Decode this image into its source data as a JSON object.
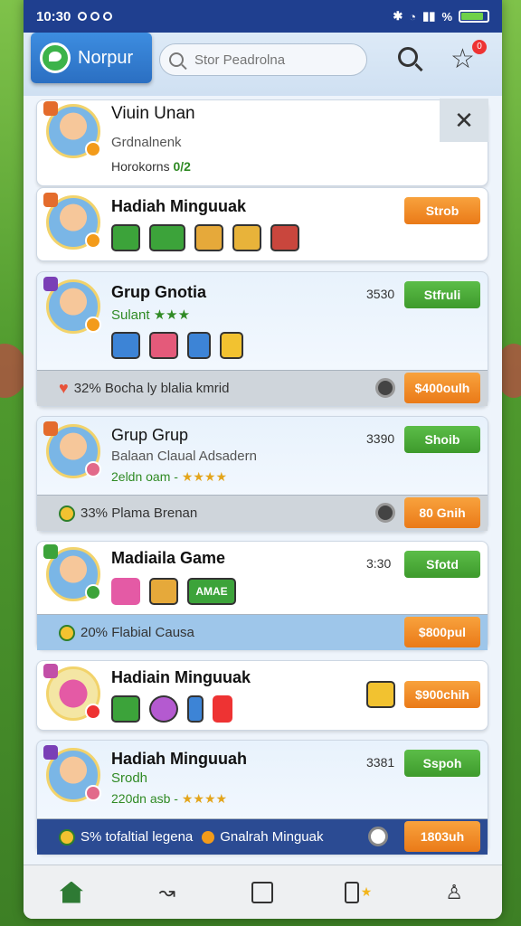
{
  "status": {
    "time": "10:30"
  },
  "app": {
    "brand": "Norpur",
    "search_placeholder": "Stor Peadrolna",
    "notif_count": "0"
  },
  "cards": [
    {
      "title": "Viuin Unan",
      "subtitle": "Grdnalnenk",
      "meta_label": "Horokorns",
      "meta_value": "0/2"
    },
    {
      "title": "Hadiah Minguuak",
      "button": "Strob"
    },
    {
      "title": "Grup Gnotia",
      "subtitle": "Sulant",
      "count": "3530",
      "button": "Stfruli",
      "footer_text": "32% Bocha ly blalia kmrid",
      "footer_button": "$400oulh"
    },
    {
      "title": "Grup Grup",
      "subtitle": "Balaan Claual Adsadern",
      "meta": "2eldn oam -",
      "count": "3390",
      "button": "Shoib",
      "footer_text": "33% Plama Brenan",
      "footer_button": "80 Gnih"
    },
    {
      "title": "Madiaila Game",
      "count": "3:30",
      "button": "Sfotd",
      "item_badge": "AMAE",
      "footer_text": "20% Flabial Causa",
      "footer_button": "$800pul"
    },
    {
      "title": "Hadiain Minguuak",
      "footer_button": "$900chih"
    },
    {
      "title": "Hadiah Minguuah",
      "subtitle": "Srodh",
      "meta": "220dn asb -",
      "count": "3381",
      "button": "Sspoh",
      "footer_text": "S% tofaltial legena",
      "footer_text2": "Gnalrah Minguak",
      "footer_button": "1803uh"
    }
  ],
  "nav": {
    "items": [
      "home-icon",
      "share-icon",
      "puzzle-icon",
      "bookmark-icon",
      "profile-icon"
    ]
  }
}
